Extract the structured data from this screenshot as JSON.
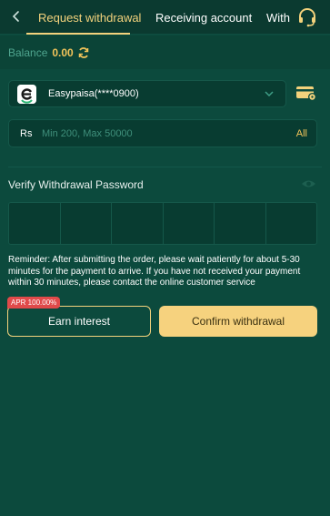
{
  "header": {
    "tabs": [
      {
        "label": "Request withdrawal",
        "active": true
      },
      {
        "label": "Receiving account",
        "active": false
      },
      {
        "label": "With",
        "active": false
      }
    ]
  },
  "balance": {
    "label": "Balance",
    "value": "0.00"
  },
  "account": {
    "name": "Easypaisa(****0900)"
  },
  "amount": {
    "currency": "Rs",
    "placeholder": "Min 200, Max 50000",
    "all_label": "All"
  },
  "verify": {
    "title": "Verify Withdrawal Password"
  },
  "reminder": "Reminder:  After submitting the order, please wait patiently for about 5-30 minutes for the payment to arrive. If you have not received your payment within 30 minutes, please contact the online customer service",
  "buttons": {
    "earn_label": "Earn interest",
    "apr_badge": "APR 100.00%",
    "confirm_label": "Confirm withdrawal"
  },
  "colors": {
    "background": "#0c4a3d",
    "accent": "#f3d27c",
    "balance": "#f3c45a",
    "badge": "#e04a4a"
  }
}
